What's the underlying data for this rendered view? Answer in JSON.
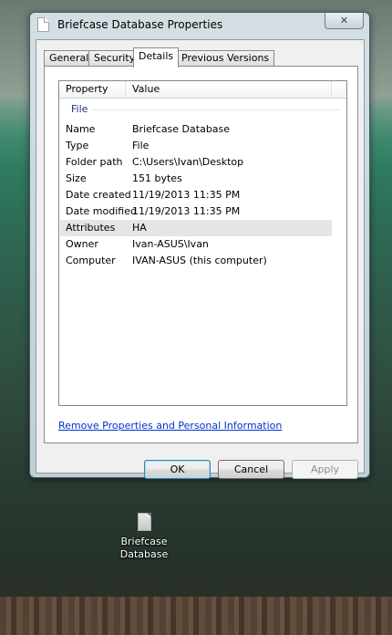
{
  "window": {
    "title": "Briefcase Database Properties",
    "close_glyph": "✕"
  },
  "tabs": [
    {
      "label": "General"
    },
    {
      "label": "Security"
    },
    {
      "label": "Details",
      "active": true
    },
    {
      "label": "Previous Versions"
    }
  ],
  "details": {
    "columns": {
      "property": "Property",
      "value": "Value"
    },
    "group": "File",
    "rows": [
      {
        "key": "Name",
        "value": "Briefcase Database"
      },
      {
        "key": "Type",
        "value": "File"
      },
      {
        "key": "Folder path",
        "value": "C:\\Users\\Ivan\\Desktop"
      },
      {
        "key": "Size",
        "value": "151 bytes"
      },
      {
        "key": "Date created",
        "value": "11/19/2013 11:35 PM"
      },
      {
        "key": "Date modified",
        "value": "11/19/2013 11:35 PM"
      },
      {
        "key": "Attributes",
        "value": "HA",
        "selected": true
      },
      {
        "key": "Owner",
        "value": "Ivan-ASUS\\Ivan"
      },
      {
        "key": "Computer",
        "value": "IVAN-ASUS (this computer)"
      }
    ]
  },
  "remove_link": "Remove Properties and Personal Information",
  "buttons": {
    "ok": "OK",
    "cancel": "Cancel",
    "apply": "Apply"
  },
  "desktop": {
    "icon_label_line1": "Briefcase",
    "icon_label_line2": "Database"
  }
}
